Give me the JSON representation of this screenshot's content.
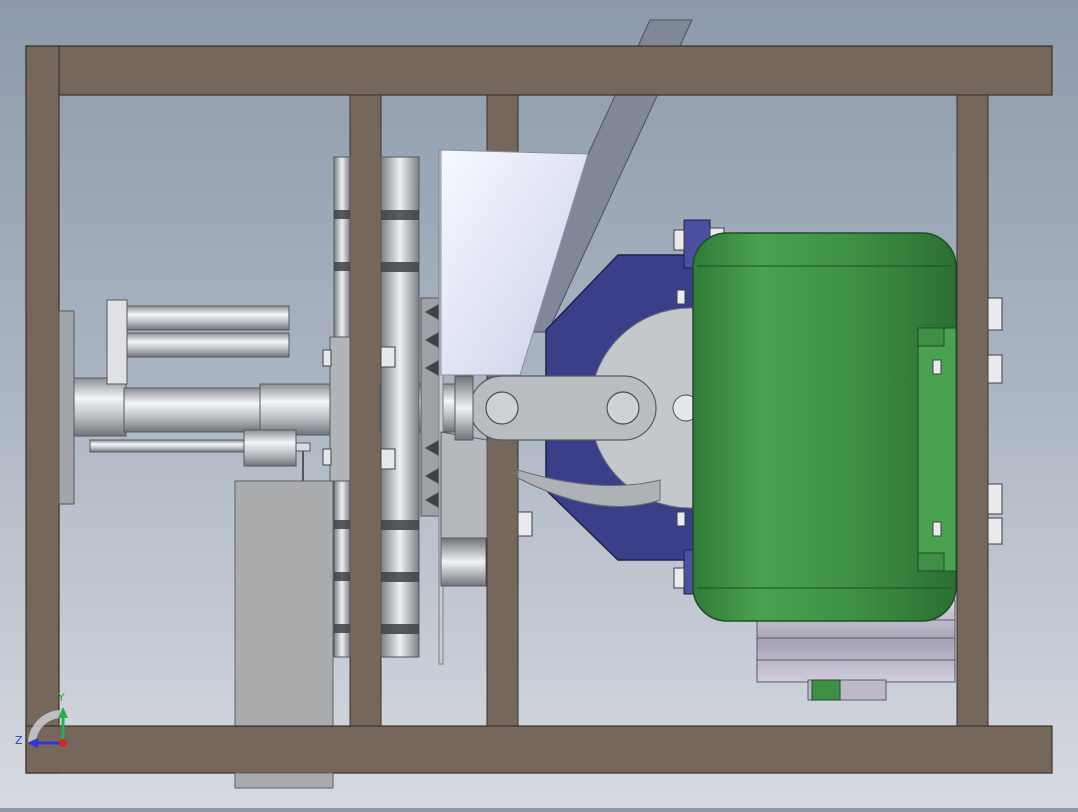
{
  "viewport": {
    "background_top": "#8d9aab",
    "background_bottom": "#d6dae1"
  },
  "colors": {
    "frame": "#75675c",
    "frame_edge": "#3a322c",
    "motor_green": "#3e8f45",
    "motor_green_light": "#6cc06f",
    "mount_blue": "#3b3f8a",
    "steel": "#b8bcc2",
    "steel_dark": "#7e8389",
    "hopper": "#dfe4f4",
    "belt": "#7f8798"
  },
  "triad": {
    "y_label": "Y",
    "z_label": "Z",
    "y_color": "#22b14c",
    "z_color": "#2a3bd9",
    "origin_color": "#e02020"
  }
}
